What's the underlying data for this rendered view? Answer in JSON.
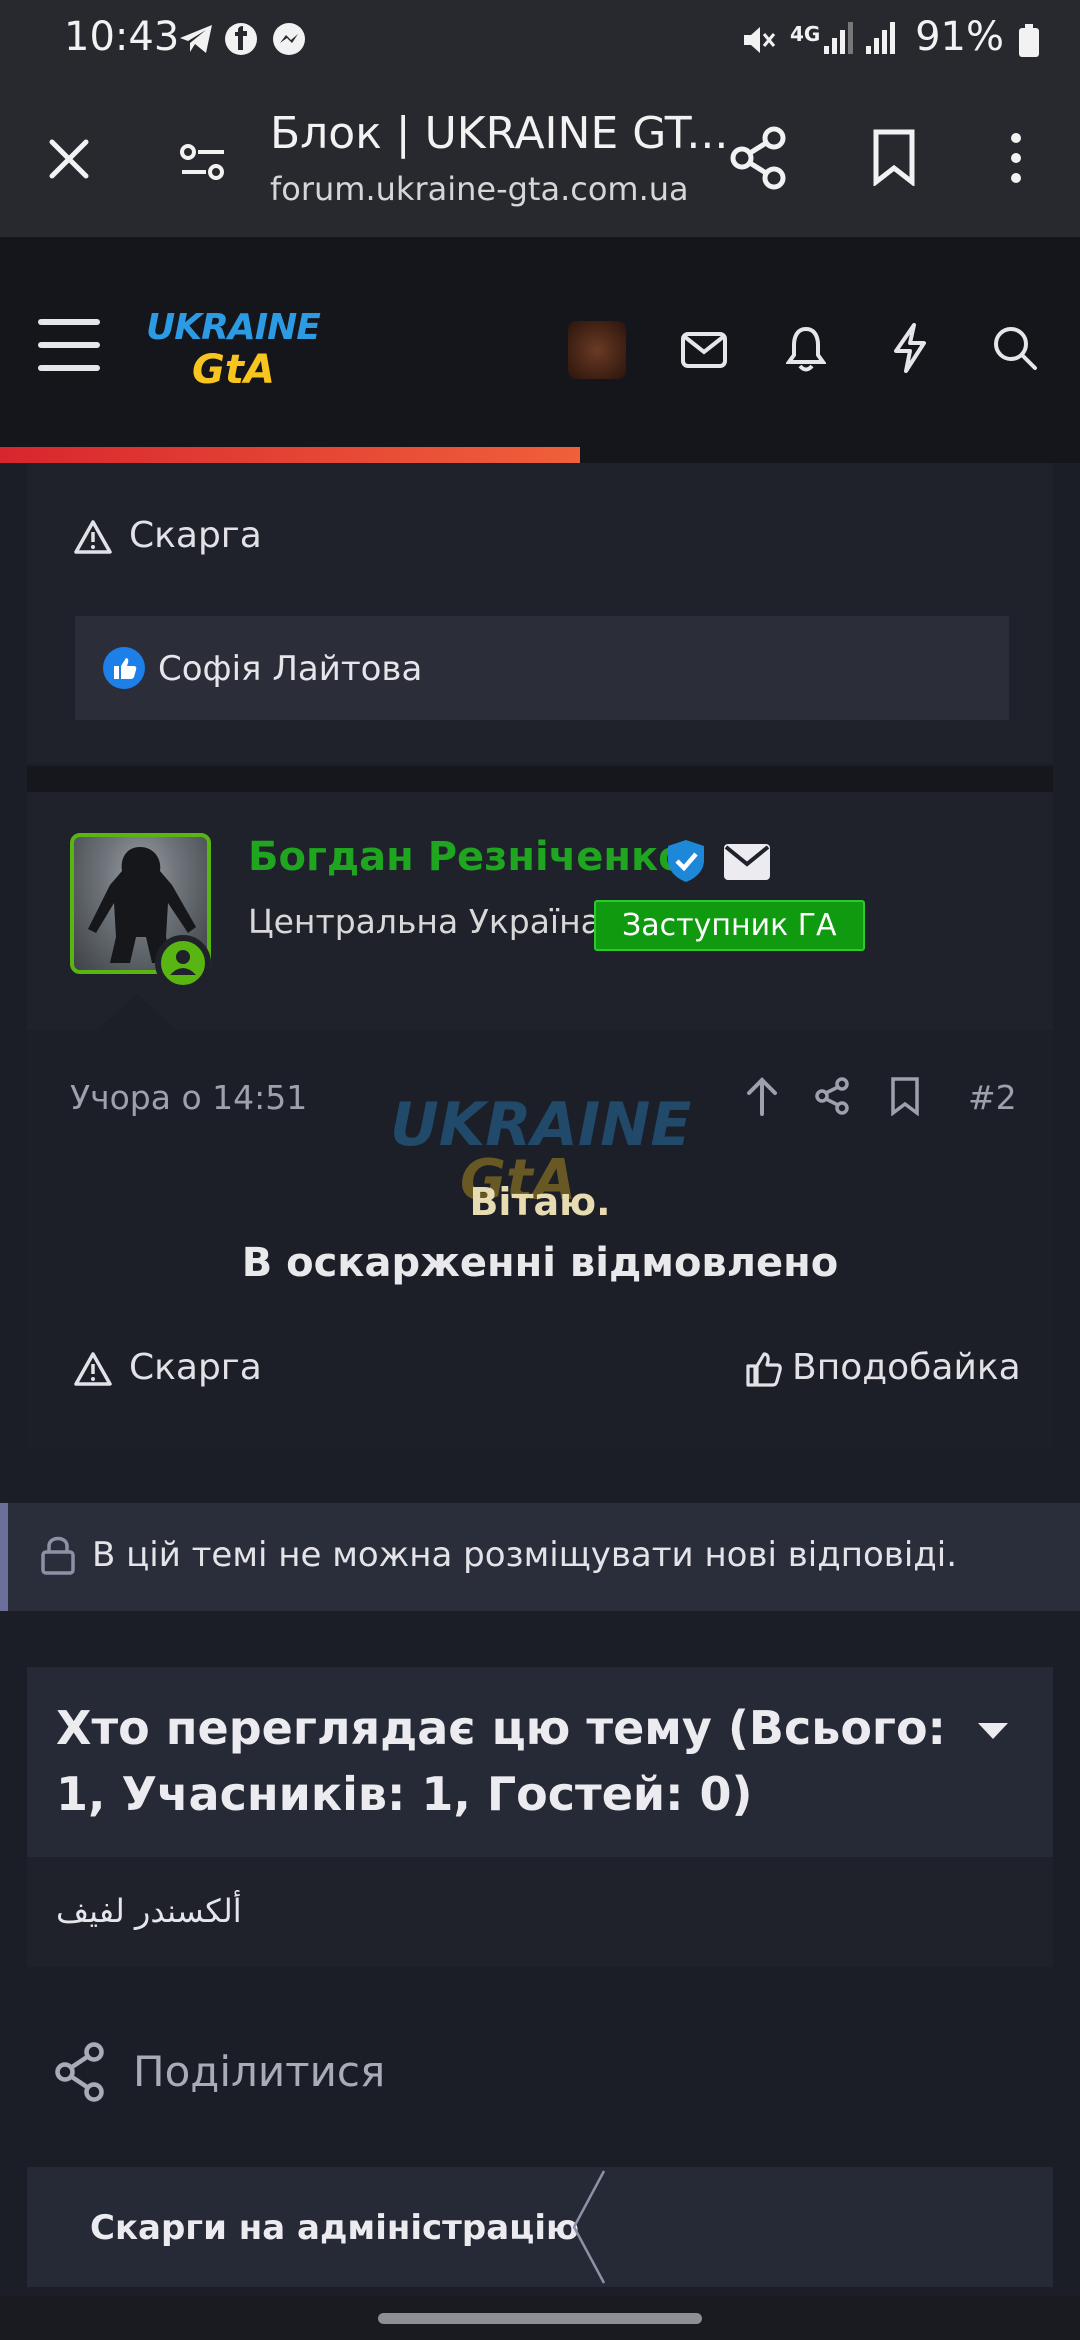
{
  "status_bar": {
    "time": "10:43",
    "network": "4G",
    "battery": "91%"
  },
  "browser": {
    "title": "Блок | UKRAINE GT...",
    "url": "forum.ukraine-gta.com.ua"
  },
  "site": {
    "logo_line1": "UKRAINE",
    "logo_line2": "GtA"
  },
  "post1": {
    "report_label": "Скарга",
    "liked_by": "Софія Лайтова"
  },
  "post2": {
    "author": "Богдан Резніченко",
    "region": "Центральна Україна",
    "role": "Заступник ГА",
    "date": "Учора о 14:51",
    "number": "#2",
    "greeting": "Вітаю.",
    "message": "В оскарженні відмовлено",
    "report_label": "Скарга",
    "like_label": "Вподобайка"
  },
  "locked_notice": "В цій темі не можна розміщувати нові відповіді.",
  "viewers": {
    "title": "Хто переглядає цю тему (Всього: 1, Учасників: 1, Гостей: 0)",
    "users": [
      "ألكسندر لفيف"
    ]
  },
  "share_label": "Поділитися",
  "breadcrumb": "Скарги на адміністрацію",
  "colors": {
    "accent_green": "#1fa51f",
    "role_badge": "#0f9a0f",
    "progress": "#e0352e",
    "background": "#1c1e27"
  }
}
